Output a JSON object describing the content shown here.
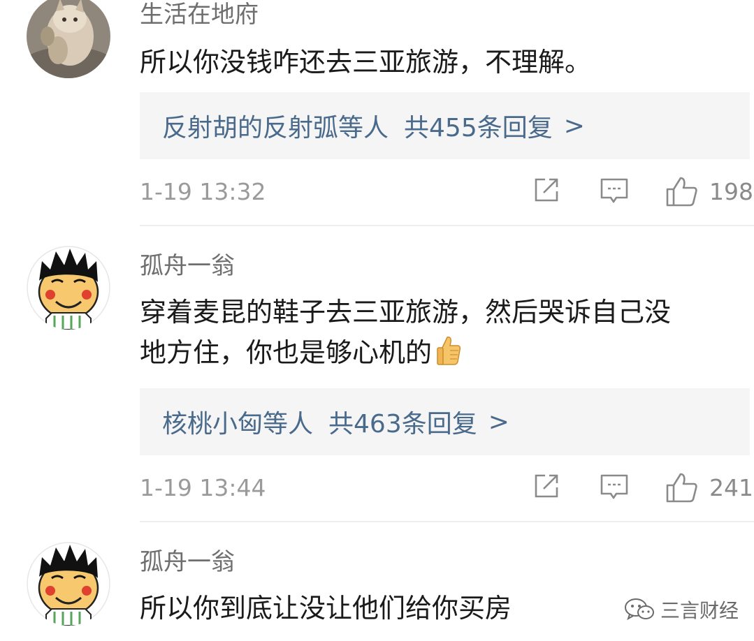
{
  "comments": [
    {
      "username": "生活在地府",
      "text": "所以你没钱咋还去三亚旅游，不理解。",
      "replies_who": "反射胡的反射弧等人",
      "replies_count": "共455条回复",
      "chevron": ">",
      "time": "1-19 13:32",
      "likes": "198",
      "avatar": "cat-photo-avatar"
    },
    {
      "username": "孤舟一翁",
      "text_line1": "穿着麦昆的鞋子去三亚旅游，然后哭诉自己没",
      "text_line2": "地方住，你也是够心机的",
      "emoji": "thumbs-up-emoji",
      "replies_who": "核桃小匈等人",
      "replies_count": "共463条回复",
      "chevron": ">",
      "time": "1-19 13:44",
      "likes": "241",
      "avatar": "cartoon-boy-avatar"
    },
    {
      "username": "孤舟一翁",
      "text": "所以你到底让没让他们给你买房",
      "avatar": "cartoon-boy-avatar"
    }
  ],
  "watermark": {
    "text": "三言财经",
    "icon": "wechat-icon"
  },
  "icons": {
    "share": "share-icon",
    "comment": "comment-icon",
    "like": "like-icon"
  }
}
